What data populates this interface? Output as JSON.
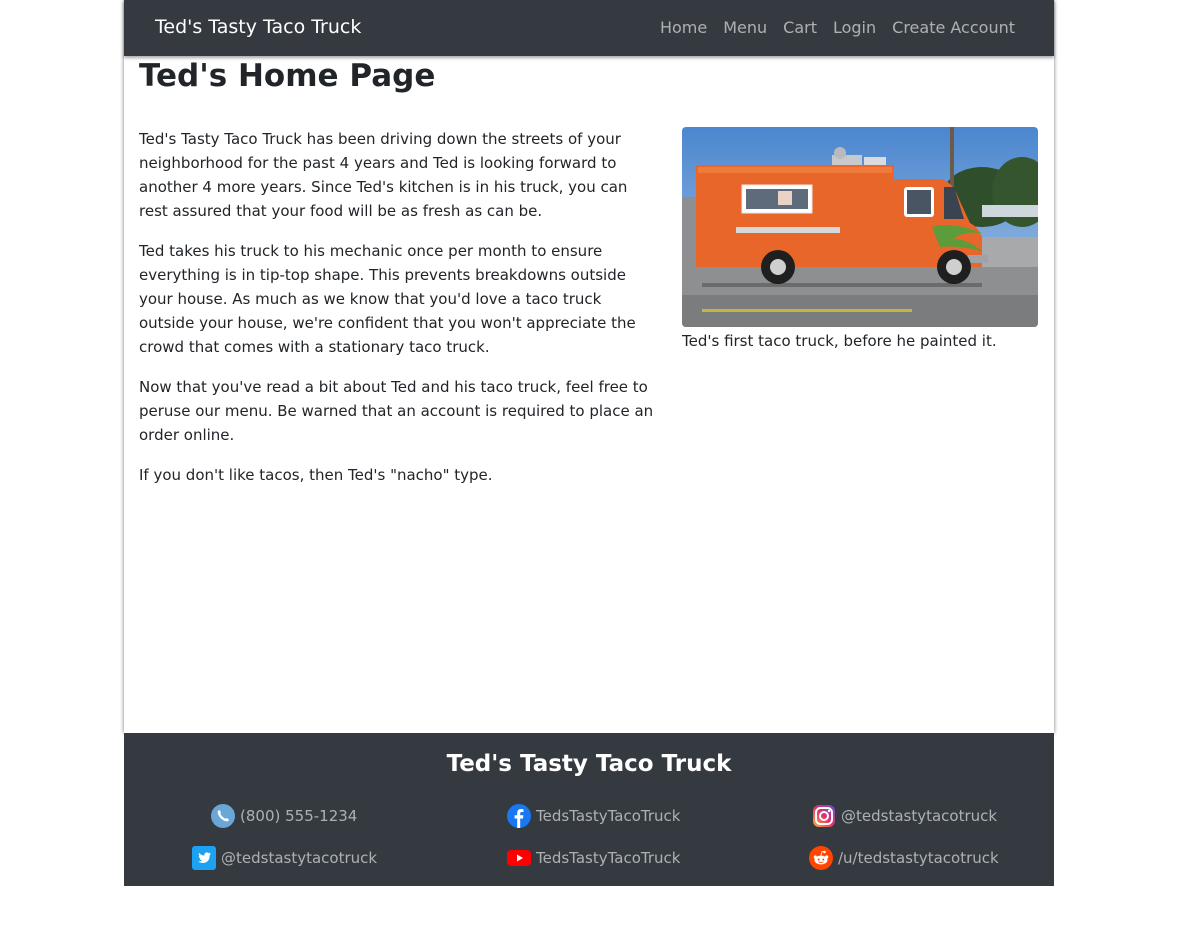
{
  "navbar": {
    "brand": "Ted's Tasty Taco Truck",
    "links": [
      "Home",
      "Menu",
      "Cart",
      "Login",
      "Create Account"
    ]
  },
  "main": {
    "title": "Ted's Home Page",
    "paragraphs": [
      "Ted's Tasty Taco Truck has been driving down the streets of your neighborhood for the past 4 years and Ted is looking forward to another 4 more years. Since Ted's kitchen is in his truck, you can rest assured that your food will be as fresh as can be.",
      "Ted takes his truck to his mechanic once per month to ensure everything is in tip-top shape. This prevents breakdowns outside your house. As much as we know that you'd love a taco truck outside your house, we're confident that you won't appreciate the crowd that comes with a stationary taco truck.",
      "Now that you've read a bit about Ted and his taco truck, feel free to peruse our menu. Be warned that an account is required to place an order online.",
      "If you don't like tacos, then Ted's \"nacho\" type."
    ],
    "image_caption": "Ted's first taco truck, before he painted it."
  },
  "footer": {
    "title": "Ted's Tasty Taco Truck",
    "contacts": [
      {
        "icon": "phone-icon",
        "text": "(800) 555-1234"
      },
      {
        "icon": "facebook-icon",
        "text": "TedsTastyTacoTruck"
      },
      {
        "icon": "instagram-icon",
        "text": "@tedstastytacotruck"
      },
      {
        "icon": "twitter-icon",
        "text": "@tedstastytacotruck"
      },
      {
        "icon": "youtube-icon",
        "text": "TedsTastyTacoTruck"
      },
      {
        "icon": "reddit-icon",
        "text": "/u/tedstastytacotruck"
      }
    ]
  },
  "colors": {
    "navbar_bg": "#343a40",
    "truck_orange": "#e8662a"
  }
}
